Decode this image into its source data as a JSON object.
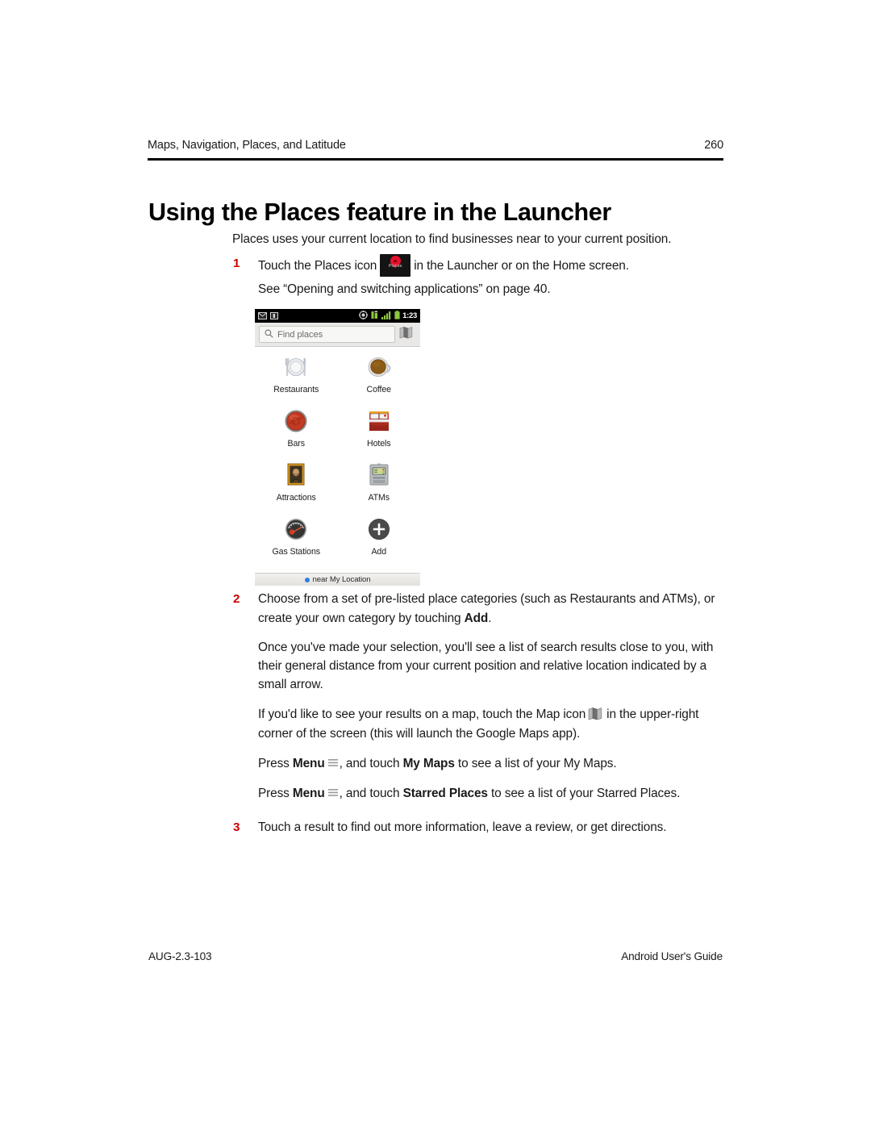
{
  "header": {
    "chapter": "Maps, Navigation, Places, and Latitude",
    "page_number": "260"
  },
  "title": "Using the Places feature in the Launcher",
  "body": {
    "intro": "Places uses your current location to find businesses near to your current position.",
    "step1": {
      "number": "1",
      "text_before_icon": "Touch the Places icon",
      "icon_name": "places-app-icon",
      "icon_label": "Places",
      "text_after_icon": "in the Launcher or on the Home screen.",
      "sub": "See “Opening and switching applications” on page 40."
    },
    "step2": {
      "number": "2",
      "line1_a": "Choose from a set of pre-listed place categories (such as Restaurants and ATMs),",
      "line1_b": "or create your own category by touching ",
      "line1_bold": "Add",
      "line1_c": ".",
      "para2": "Once you've made your selection, you'll see a list of search results close to you, with their general distance from your current position and relative location indicated by a small arrow.",
      "para3_a": "If you'd like to see your results on a map, touch the Map icon",
      "para3_b": "in the upper-right corner of the screen (this will launch the Google Maps app).",
      "map_icon_name": "map-icon",
      "mymaps_a": "Press ",
      "mymaps_menu": "Menu",
      "mymaps_b": ", and touch ",
      "mymaps_bold": "My Maps",
      "mymaps_c": " to see a list of your My Maps.",
      "starred_a": "Press ",
      "starred_menu": "Menu",
      "starred_b": ", and touch ",
      "starred_bold": "Starred Places",
      "starred_c": " to see a list of your Starred Places.",
      "menu_icon_name": "menu-icon"
    },
    "step3": {
      "number": "3",
      "text": "Touch a result to find out more information, leave a review, or get directions."
    }
  },
  "screenshot": {
    "statusbar": {
      "clock": "1:23",
      "left_icons": [
        "mail-icon",
        "sms-icon"
      ],
      "right_icons": [
        "gps-icon",
        "sync-icon",
        "signal-icon",
        "battery-icon"
      ]
    },
    "search": {
      "placeholder": "Find places",
      "search_icon": "search-icon",
      "map_button_icon": "map-icon"
    },
    "categories": [
      {
        "label": "Restaurants",
        "icon": "restaurants-icon"
      },
      {
        "label": "Coffee",
        "icon": "coffee-icon"
      },
      {
        "label": "Bars",
        "icon": "bars-icon"
      },
      {
        "label": "Hotels",
        "icon": "hotels-icon"
      },
      {
        "label": "Attractions",
        "icon": "attractions-icon"
      },
      {
        "label": "ATMs",
        "icon": "atms-icon"
      },
      {
        "label": "Gas Stations",
        "icon": "gas-stations-icon"
      },
      {
        "label": "Add",
        "icon": "add-icon"
      }
    ],
    "footer_bar": {
      "text": "near My Location",
      "dot_icon": "location-dot-icon"
    }
  },
  "footer": {
    "doc_code": "AUG-2.3-103",
    "doc_title": "Android User's Guide"
  },
  "colors": {
    "step_number": "#cc0000",
    "rule": "#000000",
    "android_green": "#8ec73f",
    "location_blue": "#2d7ce0"
  }
}
